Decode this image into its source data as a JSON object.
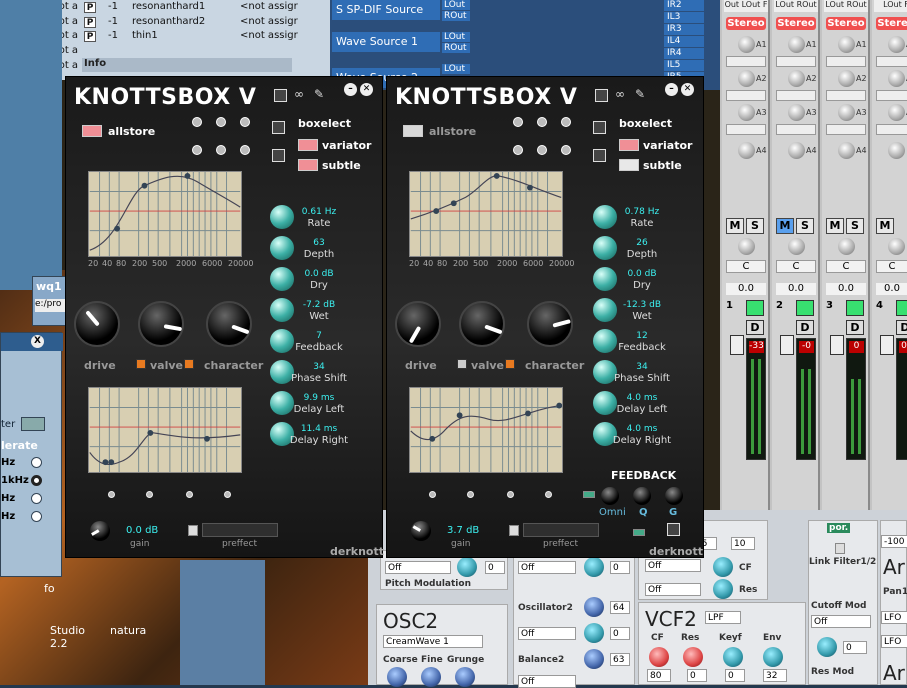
{
  "background_list": {
    "rows": [
      {
        "col0": "<not a",
        "p": "P",
        "num": "-1",
        "name": "resonanthard1",
        "assign": "<not assigr"
      },
      {
        "col0": "<not a",
        "p": "P",
        "num": "-1",
        "name": "resonanthard2",
        "assign": "<not assigr"
      },
      {
        "col0": "<not a",
        "p": "P",
        "num": "-1",
        "name": "thin1",
        "assign": "<not assigr"
      },
      {
        "col0": "<not a",
        "p": "",
        "num": "",
        "name": "",
        "assign": ""
      },
      {
        "col0": "<not a",
        "p": "",
        "num": "",
        "name": "",
        "assign": ""
      },
      {
        "col0": "<not a",
        "p": "",
        "num": "",
        "name": "",
        "assign": ""
      },
      {
        "col0": "<not a",
        "p": "",
        "num": "",
        "name": "",
        "assign": ""
      },
      {
        "col0": "<not a",
        "p": "",
        "num": "",
        "name": "",
        "assign": ""
      }
    ],
    "info_label": "Info"
  },
  "router": {
    "sources": [
      "S SP-DIF Source",
      "Wave Source 1",
      "Wave Source 2"
    ],
    "ports": [
      "LOut",
      "ROut",
      "LOut",
      "ROut",
      "LOut"
    ],
    "inputs": [
      "IR2",
      "IL3",
      "IR3",
      "IL4",
      "IR4",
      "IL5",
      "IR5"
    ]
  },
  "mixer": {
    "top_labels": [
      "Out LOut F",
      "LOut ROut",
      "LOut ROut",
      "LOut F"
    ],
    "stereo_label": "Stereo",
    "aux_labels": [
      "A1",
      "A2",
      "A3",
      "A4"
    ],
    "mute": "M",
    "solo": "S",
    "center": "C",
    "zero": "0.0",
    "channels": [
      "1",
      "2",
      "3",
      "4"
    ],
    "d_label": "D",
    "peaks": [
      "-33",
      "-0",
      "0",
      "0"
    ]
  },
  "knottsbox": [
    {
      "title": "KNOTTSBOX V",
      "allstore": "allstore",
      "allstore_color": "#f08f96",
      "boxelect": "boxelect",
      "variator": "variator",
      "subtle": "subtle",
      "variator_color": "#f08f96",
      "subtle_color": "#f08f96",
      "eq_freqs": [
        "20",
        "40",
        "80",
        "200",
        "500",
        "2000",
        "6000",
        "20000"
      ],
      "params": [
        {
          "value": "0.61 Hz",
          "name": "Rate"
        },
        {
          "value": "63",
          "name": "Depth"
        },
        {
          "value": "0.0 dB",
          "name": "Dry"
        },
        {
          "value": "-7.2 dB",
          "name": "Wet"
        },
        {
          "value": "7",
          "name": "Feedback"
        },
        {
          "value": "34",
          "name": "Phase Shift"
        },
        {
          "value": "9.9 ms",
          "name": "Delay Left"
        },
        {
          "value": "11.4 ms",
          "name": "Delay Right"
        }
      ],
      "drive": "drive",
      "valve": "valve",
      "character": "character",
      "gain_value": "0.0 dB",
      "gain_label": "gain",
      "preffect": "preffect",
      "brand": "derknott"
    },
    {
      "title": "KNOTTSBOX V",
      "allstore": "allstore",
      "allstore_color": "#d8d8d8",
      "boxelect": "boxelect",
      "variator": "variator",
      "subtle": "subtle",
      "variator_color": "#f08f96",
      "subtle_color": "#e8e8e8",
      "eq_freqs": [
        "20",
        "40",
        "80",
        "200",
        "500",
        "2000",
        "6000",
        "20000"
      ],
      "params": [
        {
          "value": "0.78 Hz",
          "name": "Rate"
        },
        {
          "value": "26",
          "name": "Depth"
        },
        {
          "value": "0.0 dB",
          "name": "Dry"
        },
        {
          "value": "-12.3 dB",
          "name": "Wet"
        },
        {
          "value": "12",
          "name": "Feedback"
        },
        {
          "value": "34",
          "name": "Phase Shift"
        },
        {
          "value": "4.0 ms",
          "name": "Delay Left"
        },
        {
          "value": "4.0 ms",
          "name": "Delay Right"
        }
      ],
      "drive": "drive",
      "valve": "valve",
      "character": "character",
      "gain_value": "3.7 dB",
      "gain_label": "gain",
      "preffect": "preffect",
      "brand": "derknott",
      "feedback_title": "FEEDBACK",
      "omni": "Omni",
      "q": "Q",
      "g": "G"
    }
  ],
  "synth": {
    "off": "Off",
    "zero": "0",
    "pitch_mod": "Pitch Modulation",
    "osc2": "OSC2",
    "osc2_wave": "CreamWave 1",
    "coarse": "Coarse",
    "fine": "Fine",
    "grunge": "Grunge",
    "oscillator2": "Oscillator2",
    "osc2_val": "64",
    "balance2": "Balance2",
    "bal2_val": "63",
    "cf": "CF",
    "res": "Res",
    "v75": "75",
    "v10": "10",
    "vcf2": "VCF2",
    "lpf": "LPF",
    "keyf": "Keyf",
    "env": "Env",
    "v80": "80",
    "v32": "32",
    "por": "por.",
    "link": "Link Filter1/2",
    "cutoff_mod": "Cutoff Mod",
    "res_mod": "Res Mod",
    "minus100": "-100",
    "ar": "Ar",
    "pan": "Pan1",
    "lfo": "LFO"
  },
  "left": {
    "tag": "wq1",
    "path": "e:/pro",
    "ter": "ter",
    "tolerate": "lerate",
    "freqs": [
      "Hz",
      "1kHz",
      "Hz",
      "Hz"
    ],
    "studio": "Studio",
    "ver": "2.2",
    "natura": "natura",
    "info": "fo"
  }
}
